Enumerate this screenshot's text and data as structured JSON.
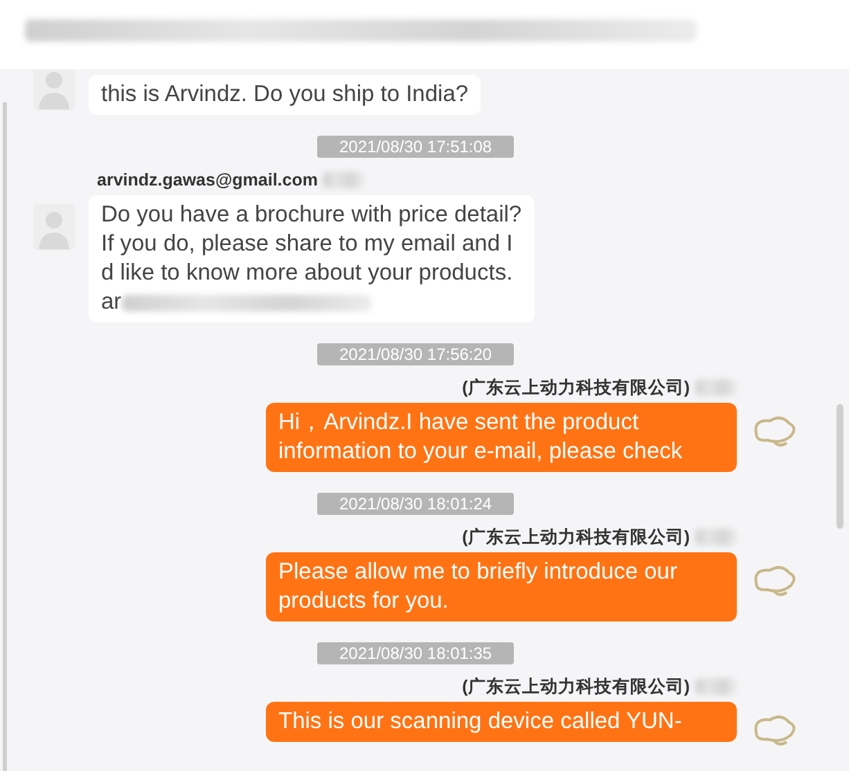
{
  "items": [
    {
      "kind": "incoming_message",
      "lines": [
        "this is Arvindz. Do you ship to India?"
      ]
    },
    {
      "kind": "timestamp",
      "text": "2021/08/30 17:51:08"
    },
    {
      "kind": "incoming_message",
      "sender": "arvindz.gawas@gmail.com",
      "lines": [
        "Do you have a brochure with price detail?",
        "If you do, please share to my email and I",
        "d like to know more about your products.",
        "ar"
      ],
      "tail_redacted": true
    },
    {
      "kind": "timestamp",
      "text": "2021/08/30 17:56:20"
    },
    {
      "kind": "outgoing_message",
      "sender": "(广东云上动力科技有限公司)",
      "lines": [
        "Hi，Arvindz.I have sent the product",
        "information to your e-mail, please check"
      ]
    },
    {
      "kind": "timestamp",
      "text": "2021/08/30 18:01:24"
    },
    {
      "kind": "outgoing_message",
      "sender": "(广东云上动力科技有限公司)",
      "lines": [
        "Please allow me to briefly introduce our",
        "products for you."
      ]
    },
    {
      "kind": "timestamp",
      "text": "2021/08/30 18:01:35"
    },
    {
      "kind": "outgoing_message",
      "sender": "(广东云上动力科技有限公司)",
      "lines": [
        "This is our scanning device called YUN-"
      ]
    }
  ]
}
